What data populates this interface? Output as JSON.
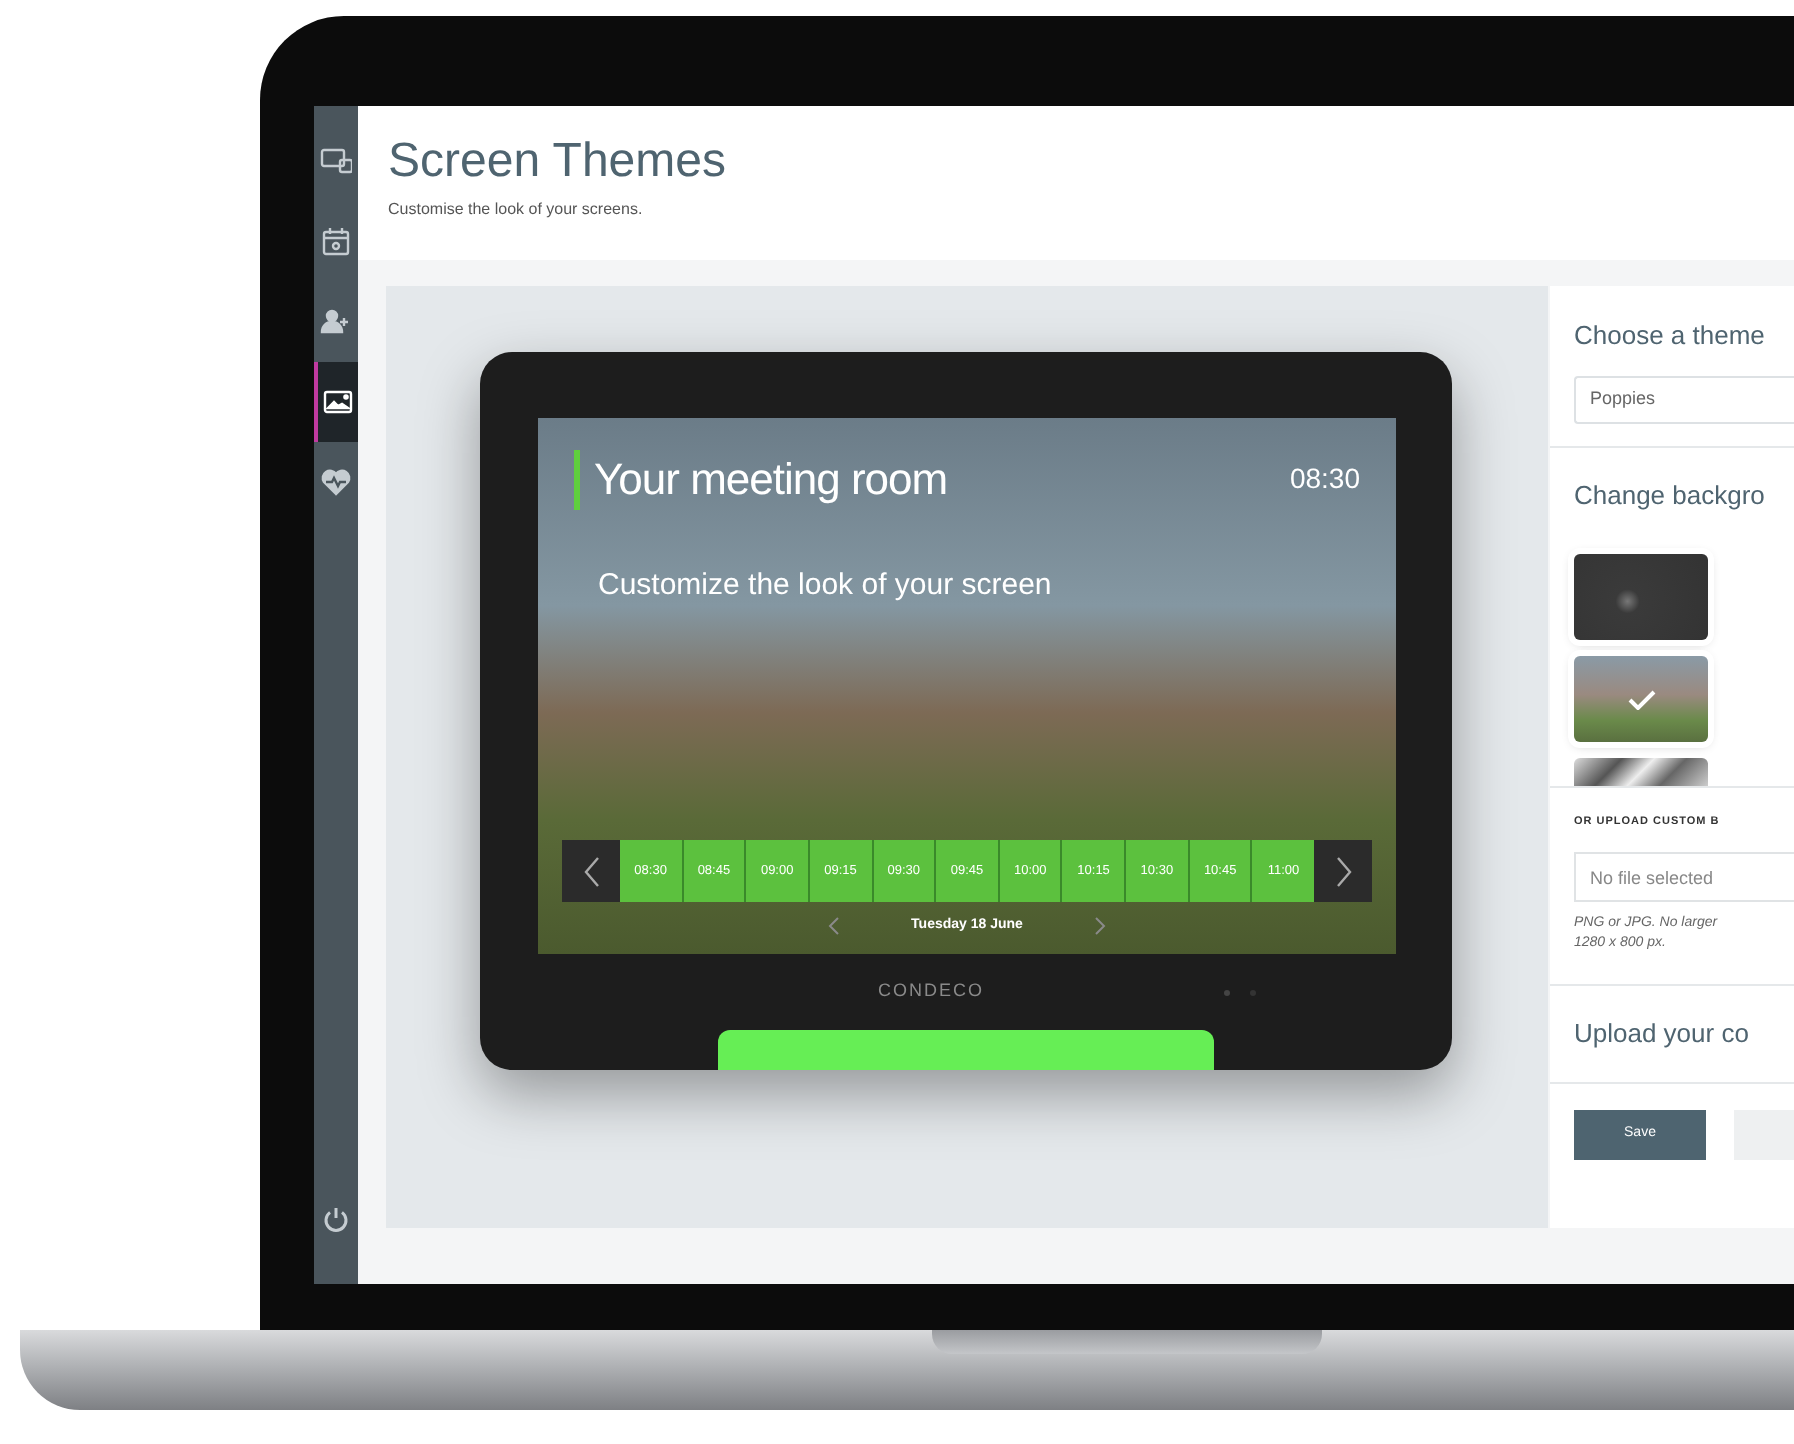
{
  "sidebar": {
    "items": [
      {
        "kind": "devices",
        "selected": false
      },
      {
        "kind": "calendar",
        "selected": false
      },
      {
        "kind": "users",
        "selected": false
      },
      {
        "kind": "image",
        "selected": true
      },
      {
        "kind": "health",
        "selected": false
      }
    ]
  },
  "header": {
    "title": "Screen Themes",
    "subtitle": "Customise the look of your screens."
  },
  "preview": {
    "room_title": "Your meeting room",
    "time": "08:30",
    "message": "Customize the look of your screen",
    "slots": [
      "08:30",
      "08:45",
      "09:00",
      "09:15",
      "09:30",
      "09:45",
      "10:00",
      "10:15",
      "10:30",
      "10:45",
      "11:00"
    ],
    "date": "Tuesday 18 June",
    "brand": "CONDECO"
  },
  "theme_panel": {
    "theme_heading": "Choose a theme",
    "theme_value": "Poppies",
    "background_heading": "Change backgro",
    "backgrounds": [
      {
        "kind": "dark",
        "selected": false
      },
      {
        "kind": "poppies",
        "selected": true
      },
      {
        "kind": "snow",
        "selected": false
      }
    ],
    "upload_heading": "OR UPLOAD CUSTOM B",
    "file_placeholder": "No file selected",
    "file_hint": "PNG or JPG. No larger",
    "file_hint_size": "1280 x 800 px.",
    "upload_logo_heading": "Upload your co",
    "save_label": "Save"
  }
}
